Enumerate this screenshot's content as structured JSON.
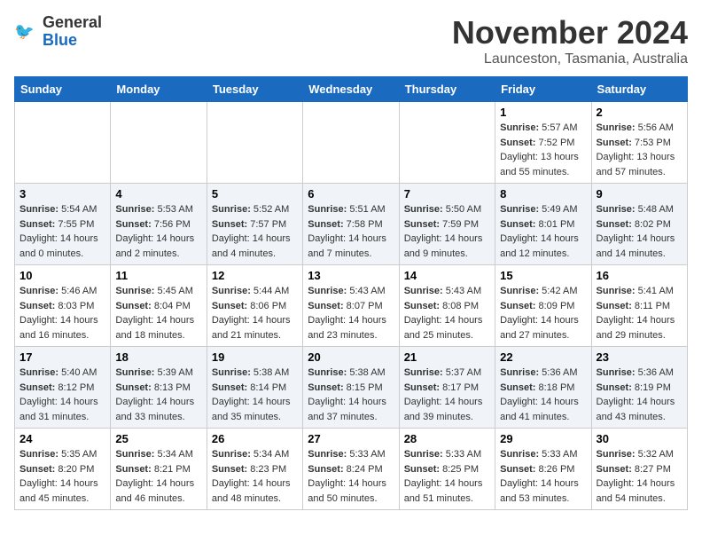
{
  "header": {
    "logo_general": "General",
    "logo_blue": "Blue",
    "month_title": "November 2024",
    "location": "Launceston, Tasmania, Australia"
  },
  "weekdays": [
    "Sunday",
    "Monday",
    "Tuesday",
    "Wednesday",
    "Thursday",
    "Friday",
    "Saturday"
  ],
  "weeks": [
    [
      {
        "day": "",
        "info": ""
      },
      {
        "day": "",
        "info": ""
      },
      {
        "day": "",
        "info": ""
      },
      {
        "day": "",
        "info": ""
      },
      {
        "day": "",
        "info": ""
      },
      {
        "day": "1",
        "sunrise": "5:57 AM",
        "sunset": "7:52 PM",
        "daylight": "13 hours and 55 minutes."
      },
      {
        "day": "2",
        "sunrise": "5:56 AM",
        "sunset": "7:53 PM",
        "daylight": "13 hours and 57 minutes."
      }
    ],
    [
      {
        "day": "3",
        "sunrise": "5:54 AM",
        "sunset": "7:55 PM",
        "daylight": "14 hours and 0 minutes."
      },
      {
        "day": "4",
        "sunrise": "5:53 AM",
        "sunset": "7:56 PM",
        "daylight": "14 hours and 2 minutes."
      },
      {
        "day": "5",
        "sunrise": "5:52 AM",
        "sunset": "7:57 PM",
        "daylight": "14 hours and 4 minutes."
      },
      {
        "day": "6",
        "sunrise": "5:51 AM",
        "sunset": "7:58 PM",
        "daylight": "14 hours and 7 minutes."
      },
      {
        "day": "7",
        "sunrise": "5:50 AM",
        "sunset": "7:59 PM",
        "daylight": "14 hours and 9 minutes."
      },
      {
        "day": "8",
        "sunrise": "5:49 AM",
        "sunset": "8:01 PM",
        "daylight": "14 hours and 12 minutes."
      },
      {
        "day": "9",
        "sunrise": "5:48 AM",
        "sunset": "8:02 PM",
        "daylight": "14 hours and 14 minutes."
      }
    ],
    [
      {
        "day": "10",
        "sunrise": "5:46 AM",
        "sunset": "8:03 PM",
        "daylight": "14 hours and 16 minutes."
      },
      {
        "day": "11",
        "sunrise": "5:45 AM",
        "sunset": "8:04 PM",
        "daylight": "14 hours and 18 minutes."
      },
      {
        "day": "12",
        "sunrise": "5:44 AM",
        "sunset": "8:06 PM",
        "daylight": "14 hours and 21 minutes."
      },
      {
        "day": "13",
        "sunrise": "5:43 AM",
        "sunset": "8:07 PM",
        "daylight": "14 hours and 23 minutes."
      },
      {
        "day": "14",
        "sunrise": "5:43 AM",
        "sunset": "8:08 PM",
        "daylight": "14 hours and 25 minutes."
      },
      {
        "day": "15",
        "sunrise": "5:42 AM",
        "sunset": "8:09 PM",
        "daylight": "14 hours and 27 minutes."
      },
      {
        "day": "16",
        "sunrise": "5:41 AM",
        "sunset": "8:11 PM",
        "daylight": "14 hours and 29 minutes."
      }
    ],
    [
      {
        "day": "17",
        "sunrise": "5:40 AM",
        "sunset": "8:12 PM",
        "daylight": "14 hours and 31 minutes."
      },
      {
        "day": "18",
        "sunrise": "5:39 AM",
        "sunset": "8:13 PM",
        "daylight": "14 hours and 33 minutes."
      },
      {
        "day": "19",
        "sunrise": "5:38 AM",
        "sunset": "8:14 PM",
        "daylight": "14 hours and 35 minutes."
      },
      {
        "day": "20",
        "sunrise": "5:38 AM",
        "sunset": "8:15 PM",
        "daylight": "14 hours and 37 minutes."
      },
      {
        "day": "21",
        "sunrise": "5:37 AM",
        "sunset": "8:17 PM",
        "daylight": "14 hours and 39 minutes."
      },
      {
        "day": "22",
        "sunrise": "5:36 AM",
        "sunset": "8:18 PM",
        "daylight": "14 hours and 41 minutes."
      },
      {
        "day": "23",
        "sunrise": "5:36 AM",
        "sunset": "8:19 PM",
        "daylight": "14 hours and 43 minutes."
      }
    ],
    [
      {
        "day": "24",
        "sunrise": "5:35 AM",
        "sunset": "8:20 PM",
        "daylight": "14 hours and 45 minutes."
      },
      {
        "day": "25",
        "sunrise": "5:34 AM",
        "sunset": "8:21 PM",
        "daylight": "14 hours and 46 minutes."
      },
      {
        "day": "26",
        "sunrise": "5:34 AM",
        "sunset": "8:23 PM",
        "daylight": "14 hours and 48 minutes."
      },
      {
        "day": "27",
        "sunrise": "5:33 AM",
        "sunset": "8:24 PM",
        "daylight": "14 hours and 50 minutes."
      },
      {
        "day": "28",
        "sunrise": "5:33 AM",
        "sunset": "8:25 PM",
        "daylight": "14 hours and 51 minutes."
      },
      {
        "day": "29",
        "sunrise": "5:33 AM",
        "sunset": "8:26 PM",
        "daylight": "14 hours and 53 minutes."
      },
      {
        "day": "30",
        "sunrise": "5:32 AM",
        "sunset": "8:27 PM",
        "daylight": "14 hours and 54 minutes."
      }
    ]
  ],
  "labels": {
    "sunrise": "Sunrise:",
    "sunset": "Sunset:",
    "daylight": "Daylight:"
  }
}
